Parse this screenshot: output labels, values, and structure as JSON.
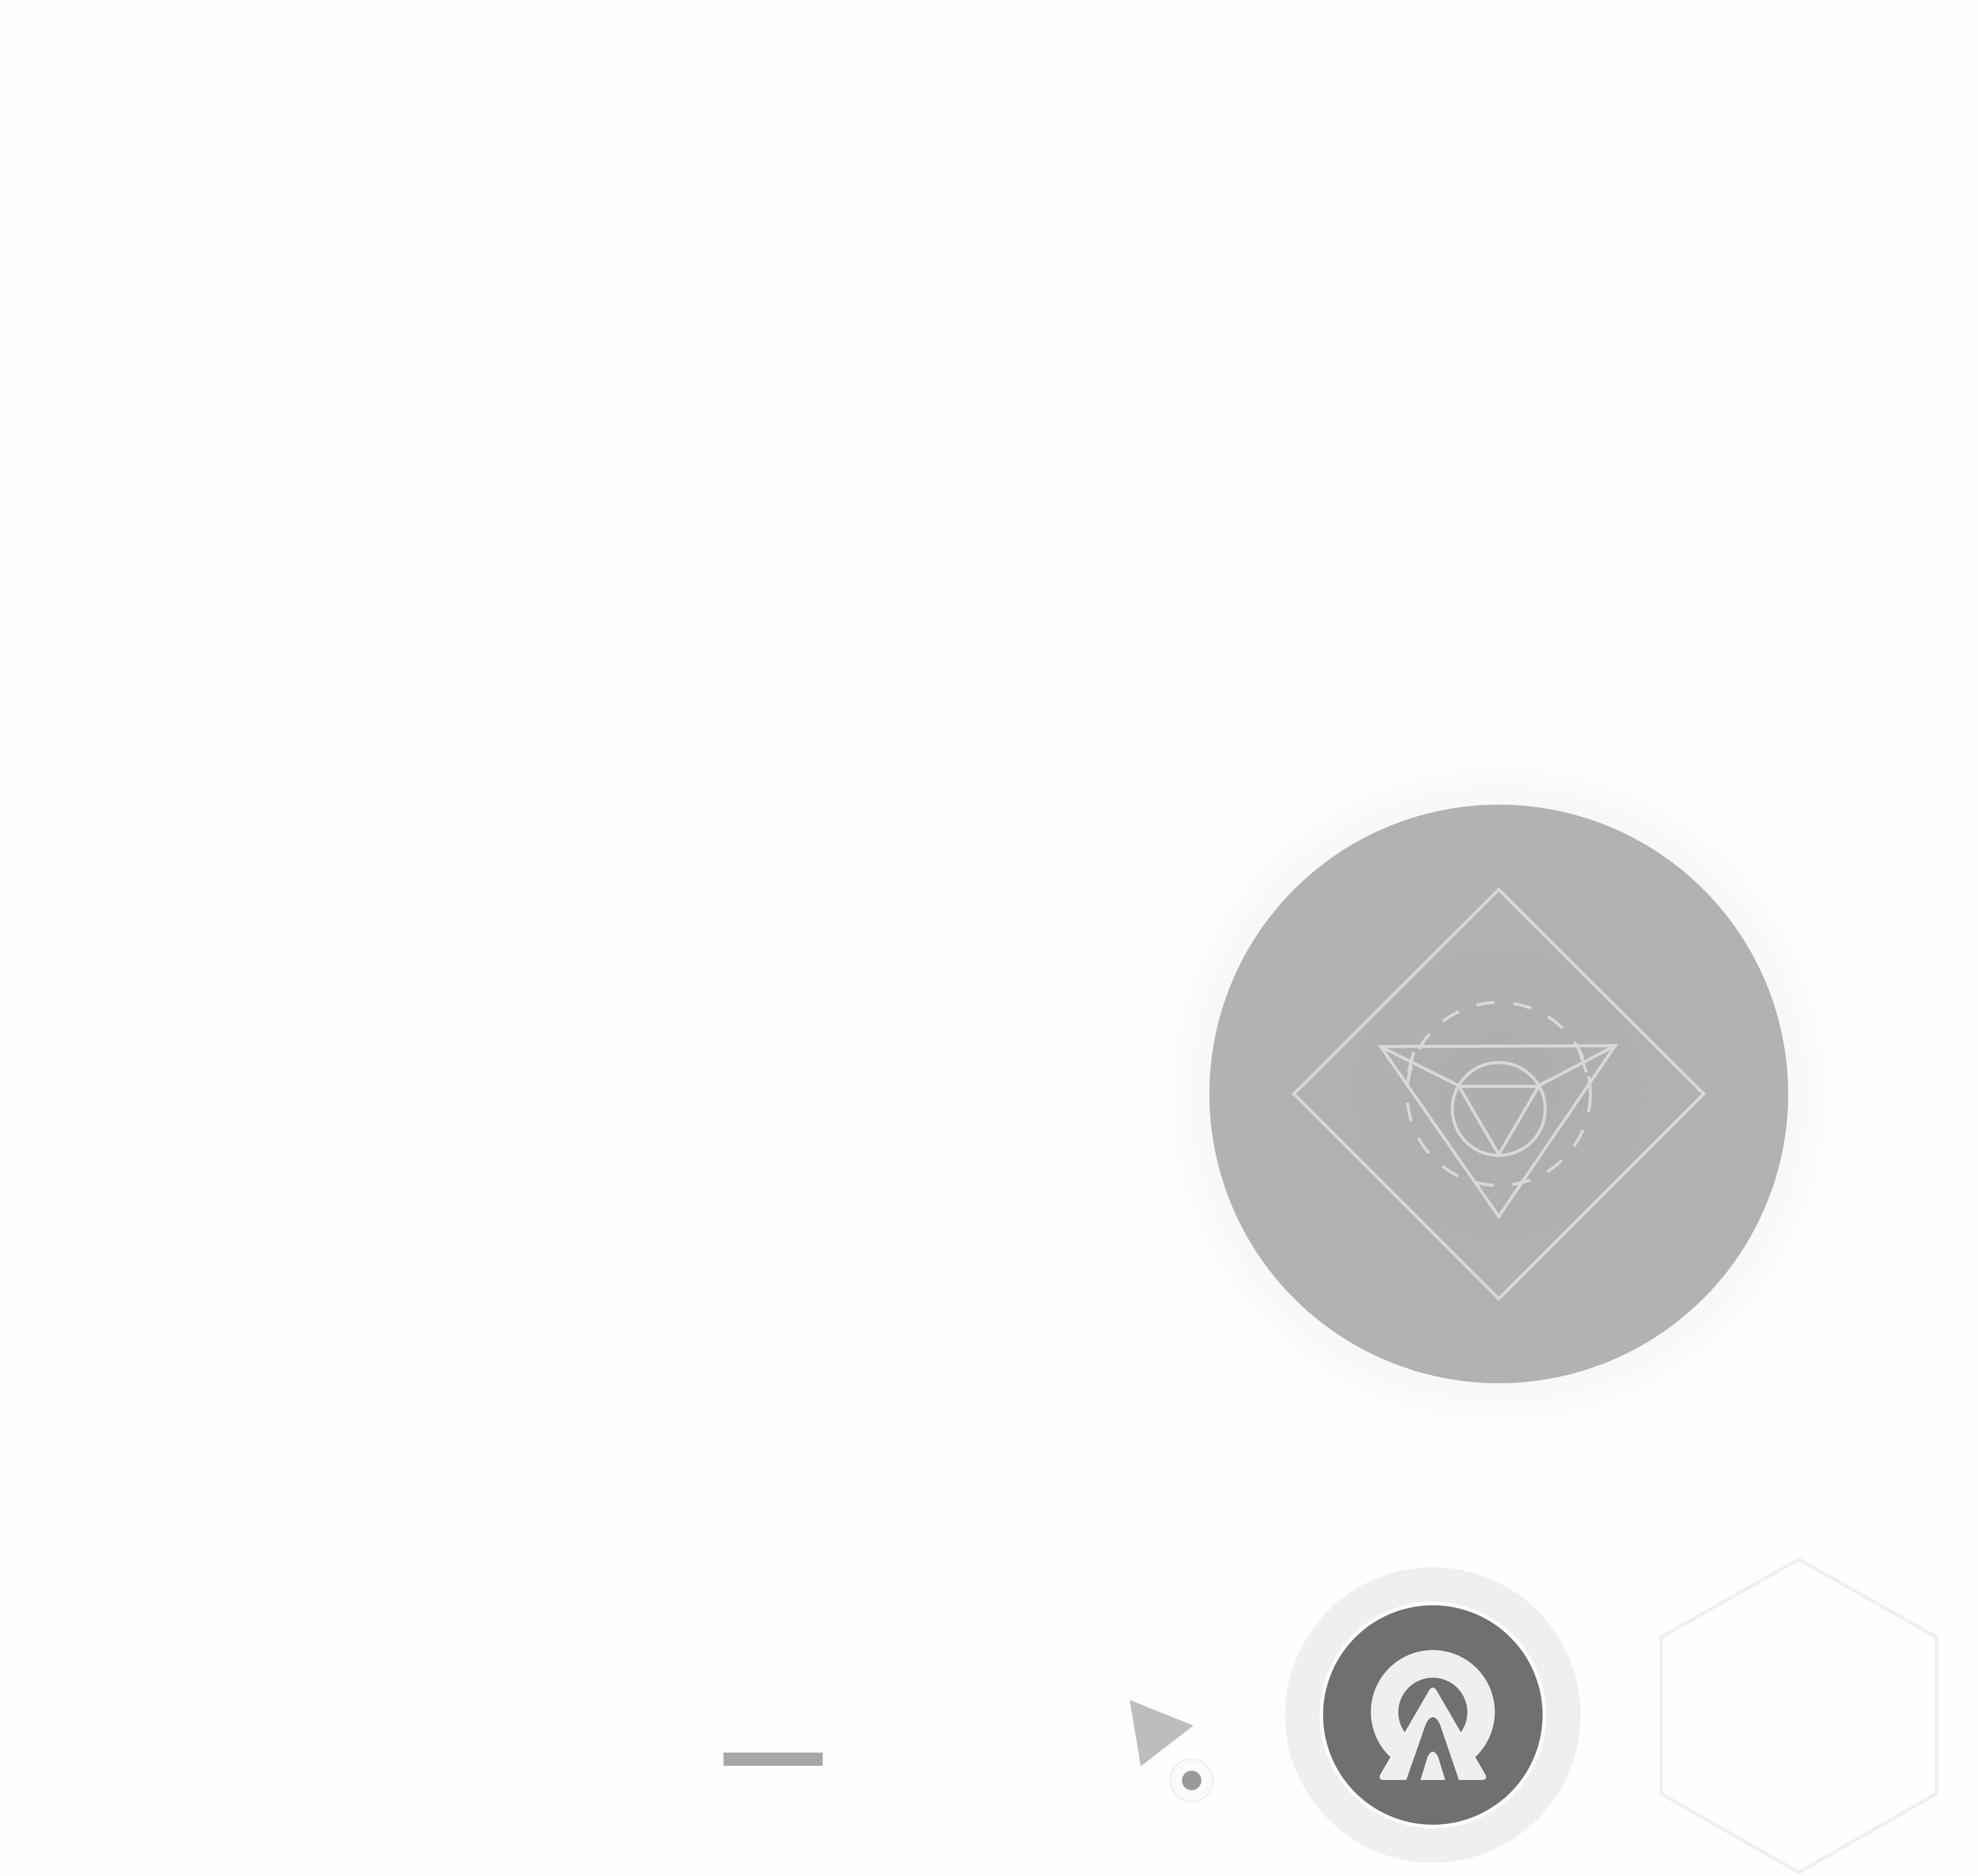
{
  "screen": {
    "background": "#fefefe"
  },
  "main_orb": {
    "icon": "sacred-geometry-icon",
    "fill_color": "#b2b2b2",
    "halo_color": "#f4f4f4",
    "line_color": "#d8d8d8"
  },
  "dash_indicator": {
    "icon": "minus-icon",
    "color": "#a6a6a6"
  },
  "pointer": {
    "icon": "cursor-arrow-icon",
    "color": "#bdbdbd"
  },
  "dot_indicator": {
    "icon": "dot-icon",
    "color": "#9a9a9a"
  },
  "app_badge": {
    "icon": "arch-omega-logo-icon",
    "fill_color": "#707070",
    "ring_color": "#efefef"
  },
  "hex_slot": {
    "icon": "hexagon-outline-icon",
    "stroke_color": "#efefef"
  }
}
